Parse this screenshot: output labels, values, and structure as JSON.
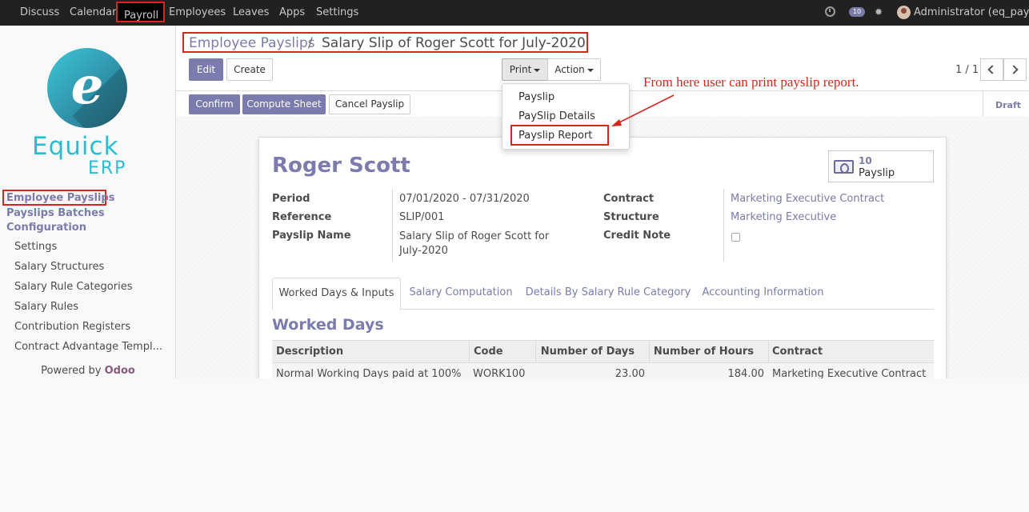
{
  "topnav": {
    "menu": [
      "Discuss",
      "Calendar",
      "Payroll",
      "Employees",
      "Leaves",
      "Apps",
      "Settings"
    ],
    "active": "Payroll",
    "chat_count": "10",
    "user": "Administrator (eq_paysl..."
  },
  "sidebar": {
    "logo_word": "Equick",
    "logo_erp": "ERP",
    "active_item": "Employee Payslips",
    "headers": [
      "Payslips Batches",
      "Configuration"
    ],
    "items": [
      "Settings",
      "Salary Structures",
      "Salary Rule Categories",
      "Salary Rules",
      "Contribution Registers",
      "Contract Advantage Templ..."
    ],
    "powered_prefix": "Powered by",
    "powered_brand": "Odoo"
  },
  "breadcrumb": {
    "parent": "Employee Payslips",
    "separator": "/",
    "current": "Salary Slip of Roger Scott for July-2020"
  },
  "toolbar": {
    "edit": "Edit",
    "create": "Create",
    "print": "Print",
    "action": "Action",
    "pager": "1 / 1"
  },
  "print_menu": [
    "Payslip",
    "PaySlip Details",
    "Payslip Report"
  ],
  "annotation": "From here user can print payslip report.",
  "statusbar": {
    "confirm": "Confirm",
    "compute": "Compute Sheet",
    "cancel": "Cancel Payslip",
    "state": "Draft"
  },
  "form": {
    "employee": "Roger Scott",
    "stat_count": "10",
    "stat_label": "Payslip",
    "left_fields": [
      {
        "label": "Period",
        "value": "07/01/2020 - 07/31/2020"
      },
      {
        "label": "Reference",
        "value": "SLIP/001"
      },
      {
        "label": "Payslip Name",
        "value": "Salary Slip of Roger Scott for July-2020"
      }
    ],
    "right_fields": [
      {
        "label": "Contract",
        "value": "Marketing Executive Contract"
      },
      {
        "label": "Structure",
        "value": "Marketing Executive"
      },
      {
        "label": "Credit Note",
        "value": ""
      }
    ],
    "credit_note_checked": false,
    "tabs": [
      "Worked Days & Inputs",
      "Salary Computation",
      "Details By Salary Rule Category",
      "Accounting Information"
    ],
    "active_tab": "Worked Days & Inputs",
    "section_title": "Worked Days",
    "table": {
      "columns": [
        "Description",
        "Code",
        "Number of Days",
        "Number of Hours",
        "Contract"
      ],
      "rows": [
        [
          "Normal Working Days paid at 100%",
          "WORK100",
          "23.00",
          "184.00",
          "Marketing Executive Contract"
        ]
      ]
    }
  },
  "colors": {
    "accent": "#7c7bad",
    "annotation_red": "#d9261c",
    "navbar": "#212121"
  }
}
